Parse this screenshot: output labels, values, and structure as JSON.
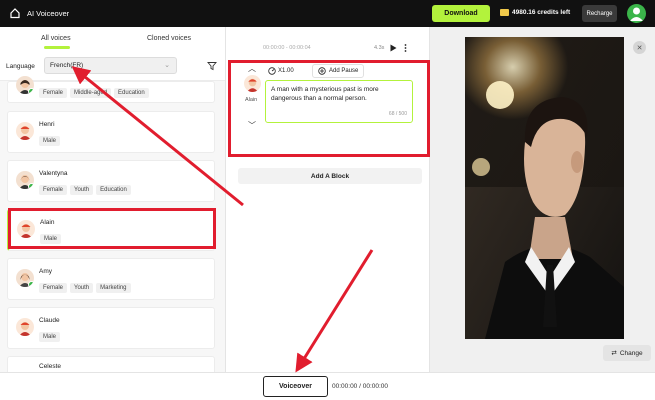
{
  "header": {
    "app_title": "AI Voiceover",
    "download_label": "Download",
    "credits_text": "4980.16 credits left",
    "recharge_label": "Recharge",
    "accent_color": "#b3f23c"
  },
  "left": {
    "tabs": [
      {
        "label": "All voices",
        "active": true
      },
      {
        "label": "Cloned voices",
        "active": false
      }
    ],
    "language_label": "Language",
    "language_value": "French(FR)",
    "voices": [
      {
        "name": "",
        "tags": [
          "Female",
          "Middle-aged",
          "Education"
        ]
      },
      {
        "name": "Henri",
        "tags": [
          "Male"
        ]
      },
      {
        "name": "Valentyna",
        "tags": [
          "Female",
          "Youth",
          "Education"
        ]
      },
      {
        "name": "Alain",
        "tags": [
          "Male"
        ],
        "selected": true
      },
      {
        "name": "Amy",
        "tags": [
          "Female",
          "Youth",
          "Marketing"
        ]
      },
      {
        "name": "Claude",
        "tags": [
          "Male"
        ]
      },
      {
        "name": "Celeste",
        "tags": []
      }
    ]
  },
  "editor": {
    "time_range": "00:00:00 - 00:00:04",
    "duration": "4.3s",
    "voice_name": "Alain",
    "speed_label": "X1.00",
    "pause_label": "Add Pause",
    "text": "A man with a mysterious past is more dangerous than a normal person.",
    "char_count": "68 / 500",
    "add_block_label": "Add A Block"
  },
  "preview": {
    "change_label": "Change"
  },
  "footer": {
    "voiceover_label": "Voiceover",
    "total_time": "00:00:00 / 00:00:00"
  },
  "icons": [
    "home-icon",
    "coin-icon",
    "avatar-icon",
    "filter-icon",
    "play-icon",
    "more-icon",
    "speed-icon",
    "add-icon",
    "swap-icon",
    "close-icon"
  ]
}
